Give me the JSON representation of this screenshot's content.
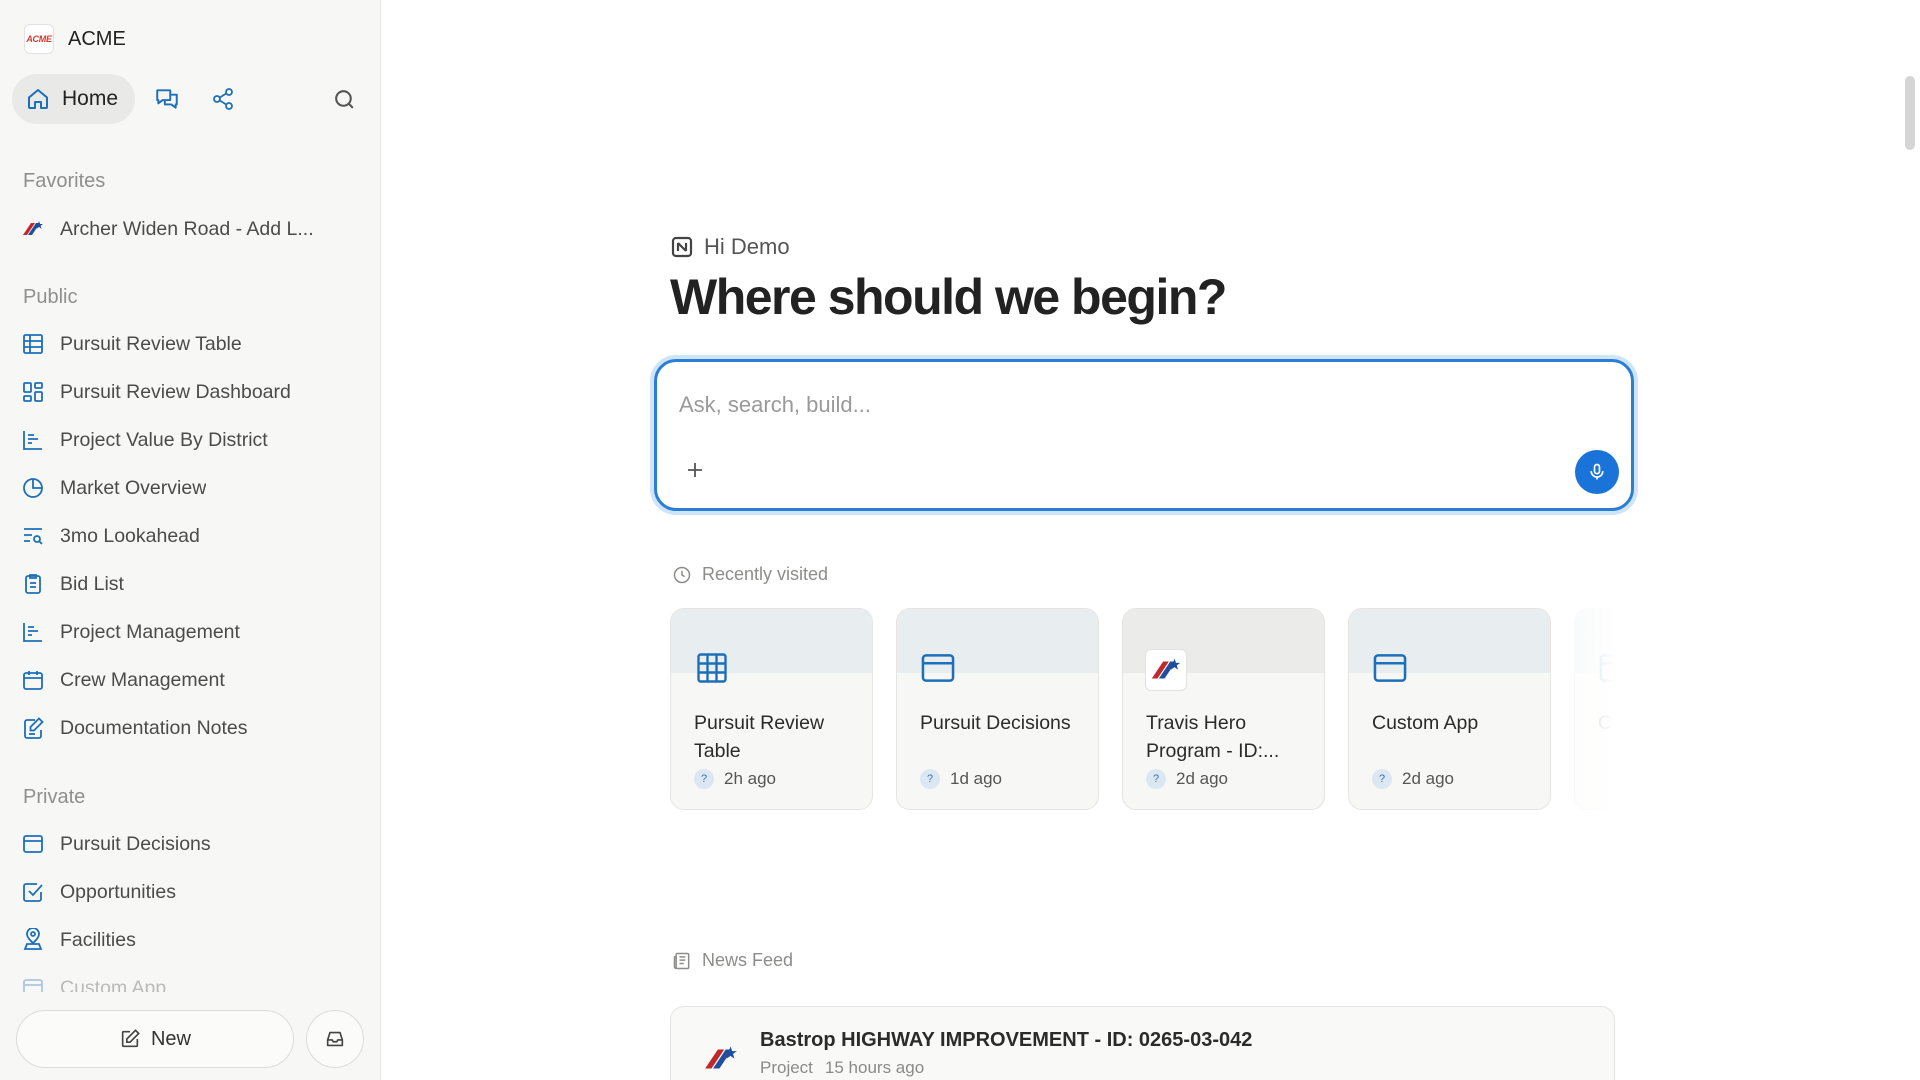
{
  "brand": {
    "name": "ACME",
    "logo_text": "ACME"
  },
  "topnav": {
    "home_label": "Home"
  },
  "sidebar": {
    "favorites_title": "Favorites",
    "favorites": [
      {
        "label": "Archer Widen Road - Add L...",
        "icon": "txdot-logo-icon"
      }
    ],
    "public_title": "Public",
    "public": [
      {
        "label": "Pursuit Review Table",
        "icon": "table-icon"
      },
      {
        "label": "Pursuit Review Dashboard",
        "icon": "dashboard-icon"
      },
      {
        "label": "Project Value By District",
        "icon": "bar-chart-icon"
      },
      {
        "label": "Market Overview",
        "icon": "pie-chart-icon"
      },
      {
        "label": "3mo Lookahead",
        "icon": "list-search-icon"
      },
      {
        "label": "Bid List",
        "icon": "clipboard-icon"
      },
      {
        "label": "Project Management",
        "icon": "bar-chart-icon"
      },
      {
        "label": "Crew Management",
        "icon": "calendar-icon"
      },
      {
        "label": "Documentation Notes",
        "icon": "edit-note-icon"
      }
    ],
    "private_title": "Private",
    "private": [
      {
        "label": "Pursuit Decisions",
        "icon": "app-window-icon"
      },
      {
        "label": "Opportunities",
        "icon": "checkbox-icon"
      },
      {
        "label": "Facilities",
        "icon": "map-pin-icon"
      },
      {
        "label": "Custom App",
        "icon": "app-window-icon"
      }
    ],
    "new_label": "New"
  },
  "main": {
    "greeting": "Hi Demo",
    "headline": "Where should we begin?",
    "ask_placeholder": "Ask, search, build...",
    "recently_visited_title": "Recently visited",
    "recent": [
      {
        "title": "Pursuit Review Table",
        "time": "2h ago",
        "icon": "table-icon"
      },
      {
        "title": "Pursuit Decisions",
        "time": "1d ago",
        "icon": "app-window-icon"
      },
      {
        "title": "Travis Hero Program - ID:...",
        "time": "2d ago",
        "icon": "txdot-logo-icon"
      },
      {
        "title": "Custom App",
        "time": "2d ago",
        "icon": "app-window-icon"
      },
      {
        "title": "C",
        "time": "",
        "icon": "app-window-icon"
      }
    ],
    "news_title": "News Feed",
    "news": [
      {
        "title": "Bastrop HIGHWAY IMPROVEMENT - ID: 0265-03-042",
        "type": "Project",
        "time": "15 hours ago"
      }
    ]
  },
  "colors": {
    "accent": "#1a73d9",
    "icon_blue": "#1d6fb8",
    "focus_border": "#2a7fd4"
  }
}
